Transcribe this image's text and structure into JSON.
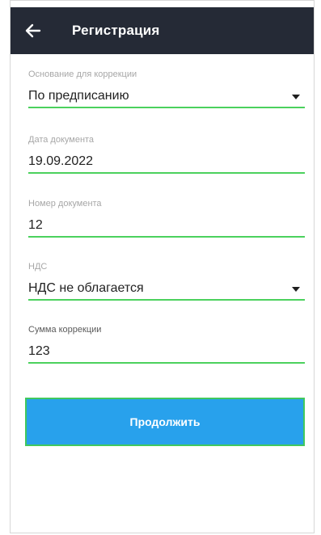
{
  "header": {
    "title": "Регистрация",
    "back_icon": "arrow-left-icon"
  },
  "form": {
    "fields": [
      {
        "label": "Основание для коррекции",
        "value": "По предписанию",
        "type": "dropdown",
        "arrow_icon": "caret-down-icon"
      },
      {
        "label": "Дата документа",
        "value": "19.09.2022",
        "type": "text"
      },
      {
        "label": "Номер документа",
        "value": "12",
        "type": "text"
      },
      {
        "label": "НДС",
        "value": "НДС не облагается",
        "type": "dropdown",
        "arrow_icon": "caret-down-icon"
      },
      {
        "label": "Сумма коррекции",
        "value": "123",
        "type": "text"
      }
    ]
  },
  "actions": {
    "continue_label": "Продолжить"
  },
  "colors": {
    "header_bg": "#252a36",
    "underline": "#4bd15d",
    "button_bg": "#28a1ec",
    "button_border": "#41c85e"
  }
}
